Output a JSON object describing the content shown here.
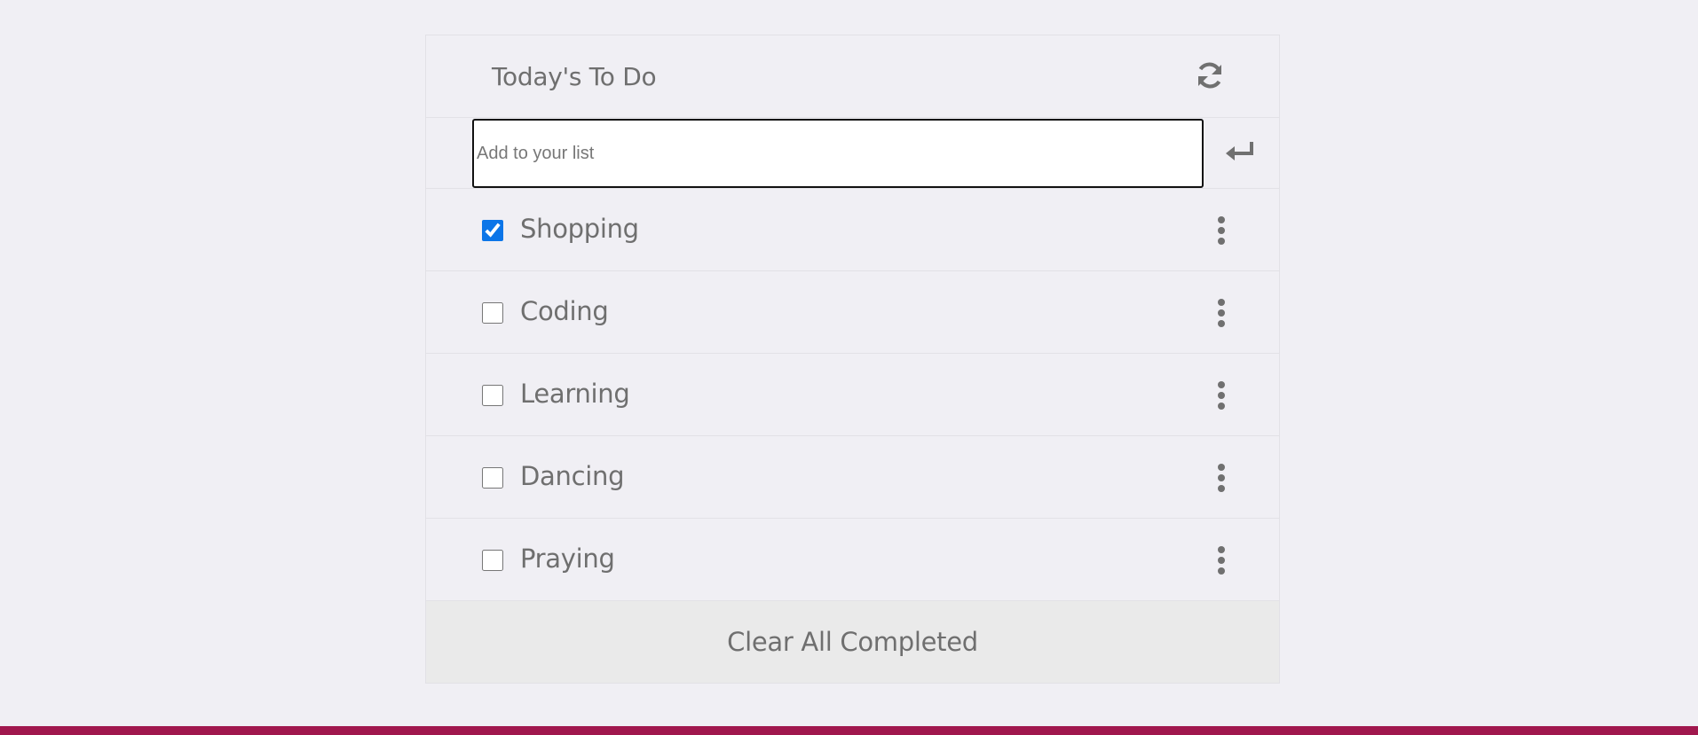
{
  "colors": {
    "background": "#f0eff4",
    "text": "#6f6f6f",
    "footer_bar": "#a0174d",
    "clear_row_bg": "#eaeaea",
    "checkbox_accent": "#0b75e8"
  },
  "header": {
    "title": "Today's To Do",
    "refresh_icon": "refresh-icon"
  },
  "add_form": {
    "placeholder": "Add to your list",
    "value": "",
    "submit_icon": "enter-icon"
  },
  "items": [
    {
      "label": "Shopping",
      "completed": true
    },
    {
      "label": "Coding",
      "completed": false
    },
    {
      "label": "Learning",
      "completed": false
    },
    {
      "label": "Dancing",
      "completed": false
    },
    {
      "label": "Praying",
      "completed": false
    }
  ],
  "footer": {
    "clear_label": "Clear All Completed"
  }
}
